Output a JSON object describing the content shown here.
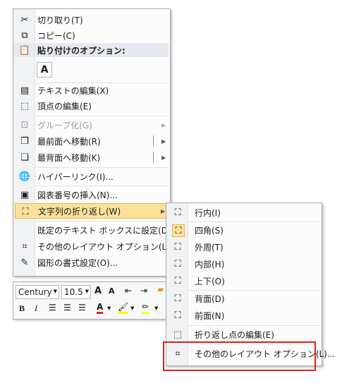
{
  "main_menu": {
    "items": [
      {
        "label": "切り取り(T)",
        "icon": "scissors-icon"
      },
      {
        "label": "コピー(C)",
        "icon": "copy-icon"
      },
      {
        "label": "貼り付けのオプション:",
        "icon": "paste-icon"
      },
      {
        "label": "テキストの編集(X)",
        "icon": "edit-text-icon"
      },
      {
        "label": "頂点の編集(E)",
        "icon": "edit-points-icon"
      },
      {
        "label": "グループ化(G)",
        "icon": "group-icon"
      },
      {
        "label": "最前面へ移動(R)",
        "icon": "bring-front-icon"
      },
      {
        "label": "最背面へ移動(K)",
        "icon": "send-back-icon"
      },
      {
        "label": "ハイパーリンク(I)...",
        "icon": "hyperlink-icon"
      },
      {
        "label": "図表番号の挿入(N)...",
        "icon": "caption-icon"
      },
      {
        "label": "文字列の折り返し(W)",
        "icon": "wrap-text-icon"
      },
      {
        "label": "既定のテキスト ボックスに設定(D)",
        "icon": ""
      },
      {
        "label": "その他のレイアウト オプション(L)...",
        "icon": "layout-options-icon"
      },
      {
        "label": "図形の書式設定(O)...",
        "icon": "format-shape-icon"
      }
    ],
    "paste_keep_text": "A"
  },
  "sub_menu": {
    "items": [
      {
        "label": "行内(I)",
        "icon": "inline-icon"
      },
      {
        "label": "四角(S)",
        "icon": "square-wrap-icon"
      },
      {
        "label": "外周(T)",
        "icon": "tight-wrap-icon"
      },
      {
        "label": "内部(H)",
        "icon": "through-wrap-icon"
      },
      {
        "label": "上下(O)",
        "icon": "top-bottom-icon"
      },
      {
        "label": "背面(D)",
        "icon": "behind-text-icon"
      },
      {
        "label": "前面(N)",
        "icon": "in-front-icon"
      },
      {
        "label": "折り返し点の編集(E)",
        "icon": "edit-wrap-points-icon"
      },
      {
        "label": "その他のレイアウト オプション(L)...",
        "icon": "layout-options-icon"
      }
    ]
  },
  "mini_toolbar": {
    "font": "Century",
    "size": "10.5",
    "grow": "A",
    "shrink": "A",
    "bold": "B",
    "italic": "I",
    "font_color": "A",
    "colors": {
      "font_color": "#e02020",
      "highlight": "#ffff00"
    }
  }
}
